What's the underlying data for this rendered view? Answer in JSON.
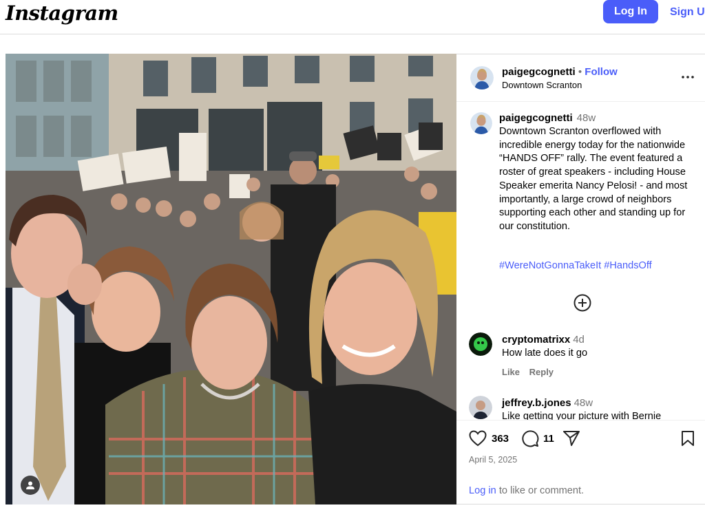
{
  "topbar": {
    "logo": "Instagram",
    "login_label": "Log In",
    "signup_label": "Sign Up"
  },
  "post": {
    "author": {
      "username": "paigegcognetti",
      "follow_label": "Follow",
      "separator": "•",
      "location": "Downtown Scranton"
    },
    "caption": {
      "username": "paigegcognetti",
      "time": "48w",
      "text": "Downtown Scranton overflowed with incredible energy today for the nationwide “HANDS OFF” rally. The event featured a roster of great speakers - including House Speaker emerita Nancy Pelosi! - and most importantly, a large crowd of neighbors supporting each other and standing up for our constitution.",
      "hashtags": "#WereNotGonnaTakeIt #HandsOff"
    },
    "comments": [
      {
        "username": "cryptomatrixx",
        "time": "4d",
        "text": "How late does it go",
        "like_label": "Like",
        "reply_label": "Reply"
      },
      {
        "username": "jeffrey.b.jones",
        "time": "48w",
        "text": "Like getting your picture with Bernie"
      }
    ],
    "likes_count": "363",
    "comments_count": "11",
    "date": "April 5, 2025",
    "login_prompt": {
      "link": "Log in",
      "rest": " to like or comment."
    }
  },
  "icons": {
    "more": "more-options-icon",
    "load_more": "plus-circle-icon",
    "like": "heart-icon",
    "comment": "comment-bubble-icon",
    "share": "paper-plane-icon",
    "save": "bookmark-icon",
    "user_tag": "user-tag-icon"
  },
  "colors": {
    "accent": "#4a5df9",
    "muted": "#737373",
    "border": "#dbdbdb"
  }
}
